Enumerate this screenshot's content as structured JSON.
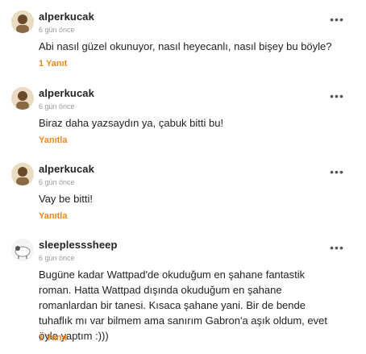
{
  "comments": [
    {
      "username": "alperkucak",
      "time": "6 gün önce",
      "text": "Abi nasıl güzel okunuyor, nasıl heyecanlı, nasıl bişey bu böyle?",
      "reply_label": "1 Yanıt",
      "avatar": "user-avatar-alperkucak"
    },
    {
      "username": "alperkucak",
      "time": "6 gün önce",
      "text": "Biraz daha yazsaydın ya, çabuk bitti bu!",
      "reply_label": "Yanıtla",
      "avatar": "user-avatar-alperkucak"
    },
    {
      "username": "alperkucak",
      "time": "6 gün önce",
      "text": "Vay be bitti!",
      "reply_label": "Yanıtla",
      "avatar": "user-avatar-alperkucak"
    },
    {
      "username": "sleeplesssheep",
      "time": "6 gün önce",
      "text": "Bugüne kadar Wattpad'de okuduğum en şahane fantastik roman. Hatta Wattpad dışında okuduğum en şahane romanlardan bir tanesi. Kısaca şahane yani. Bir de bende tuhaflık mı var bilmem ama sanırım Gabron'a aşık oldum, evet öyle yaptım :)))",
      "reply_label": "1 Yanıt",
      "avatar": "user-avatar-sleeplesssheep"
    }
  ],
  "more_icon": "more-options-icon",
  "accent_color": "#e6891f"
}
